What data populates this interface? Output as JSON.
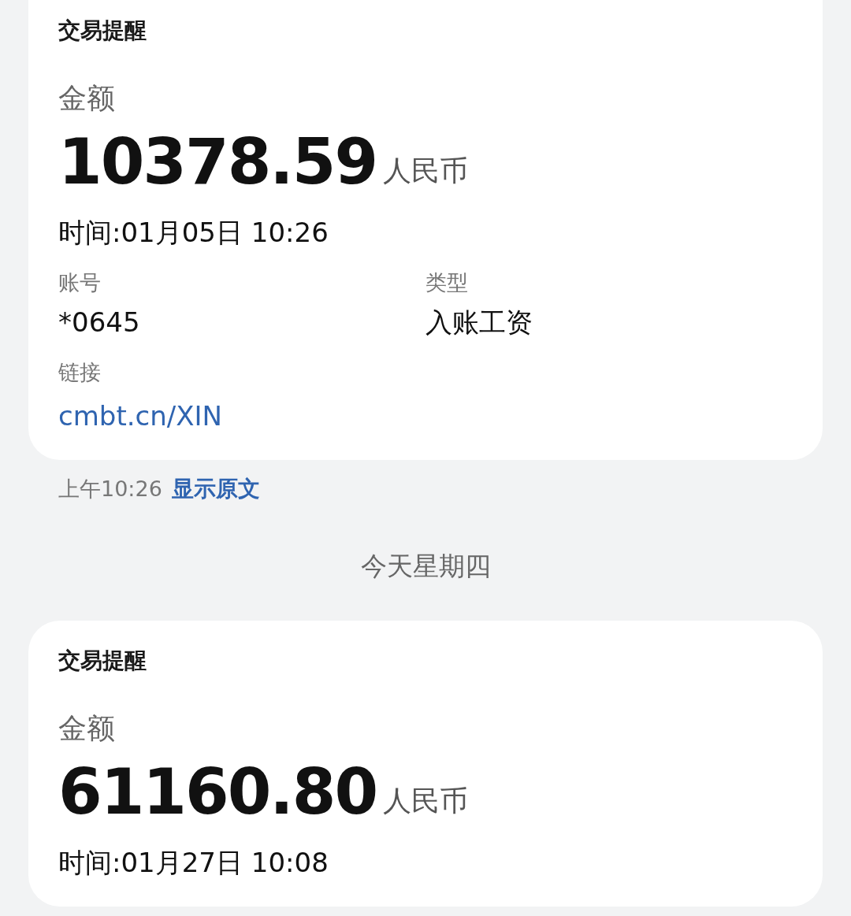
{
  "thread": [
    {
      "kind": "card",
      "title": "交易提醒",
      "amount_label": "金额",
      "amount": "10378.59",
      "currency": "人民币",
      "time": "时间:01月05日 10:26",
      "fields": [
        {
          "label": "账号",
          "value": "*0645"
        },
        {
          "label": "类型",
          "value": "入账工资"
        }
      ],
      "link": {
        "label": "链接",
        "value": "cmbt.cn/XIN"
      }
    },
    {
      "kind": "meta",
      "time": "上午10:26",
      "action": "显示原文"
    },
    {
      "kind": "divider",
      "text": "今天星期四"
    },
    {
      "kind": "card",
      "title": "交易提醒",
      "amount_label": "金额",
      "amount": "61160.80",
      "currency": "人民币",
      "time": "时间:01月27日 10:08"
    }
  ]
}
